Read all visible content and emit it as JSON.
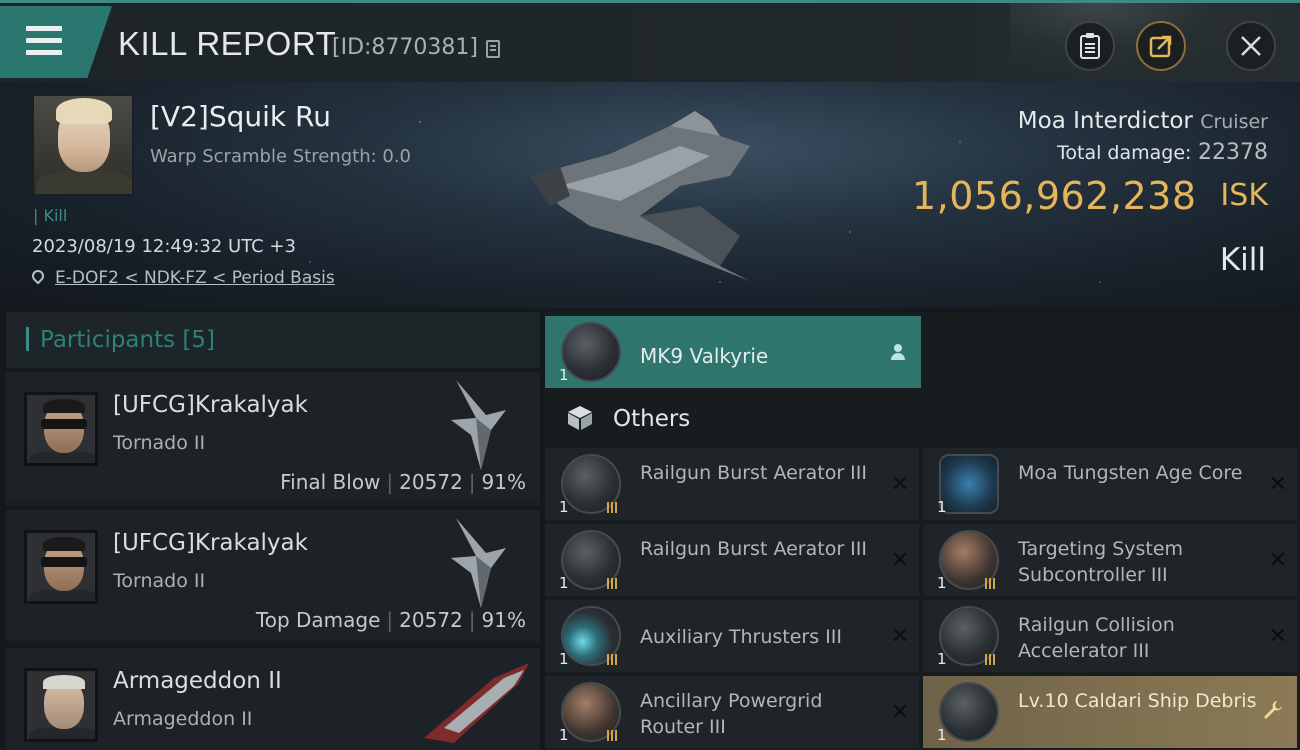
{
  "header": {
    "title": "KILL REPORT",
    "report_id": "[ID:8770381]"
  },
  "victim": {
    "name": "[V2]Squik Ru",
    "warp_scramble": "Warp Scramble Strength: 0.0",
    "kill_tag": "| Kill",
    "datetime": "2023/08/19 12:49:32 UTC +3",
    "location": "E-DOF2 < NDK-FZ < Period Basis",
    "ship_name": "Moa Interdictor",
    "ship_class": "Cruiser",
    "total_damage_label": "Total damage:",
    "total_damage": "22378",
    "isk_value": "1,056,962,238",
    "isk_unit": "ISK",
    "result": "Kill"
  },
  "participants": {
    "header": "Participants [5]",
    "rows": [
      {
        "name": "[UFCG]Krakalyak",
        "ship": "Tornado II",
        "tag": "Final Blow",
        "damage": "20572",
        "percent": "91%"
      },
      {
        "name": "[UFCG]Krakalyak",
        "ship": "Tornado II",
        "tag": "Top Damage",
        "damage": "20572",
        "percent": "91%"
      },
      {
        "name": "Armageddon II",
        "ship": "Armageddon II"
      }
    ]
  },
  "drone": {
    "qty": "1",
    "name": "MK9  Valkyrie"
  },
  "others": {
    "title": "Others",
    "items": [
      {
        "qty": "1",
        "name": "Railgun Burst Aerator III"
      },
      {
        "qty": "1",
        "name": "Moa Tungsten Age Core"
      },
      {
        "qty": "1",
        "name": "Railgun Burst Aerator III"
      },
      {
        "qty": "1",
        "name": "Targeting System Subcontroller III"
      },
      {
        "qty": "1",
        "name": "Auxiliary Thrusters III"
      },
      {
        "qty": "1",
        "name": "Railgun Collision Accelerator III"
      },
      {
        "qty": "1",
        "name": "Ancillary Powergrid Router III"
      },
      {
        "qty": "1",
        "name": "Lv.10 Caldari Ship Debris"
      }
    ]
  },
  "icons": {
    "menu": "menu-icon",
    "copy": "copy-icon",
    "clipboard": "clipboard-icon",
    "share": "share-icon",
    "close": "close-icon",
    "location": "location-pin-icon",
    "cube": "cube-icon",
    "person": "person-icon",
    "remove": "close-icon",
    "wrench": "wrench-icon"
  },
  "colors": {
    "accent": "#2e756d",
    "gold": "#e5b55a"
  }
}
